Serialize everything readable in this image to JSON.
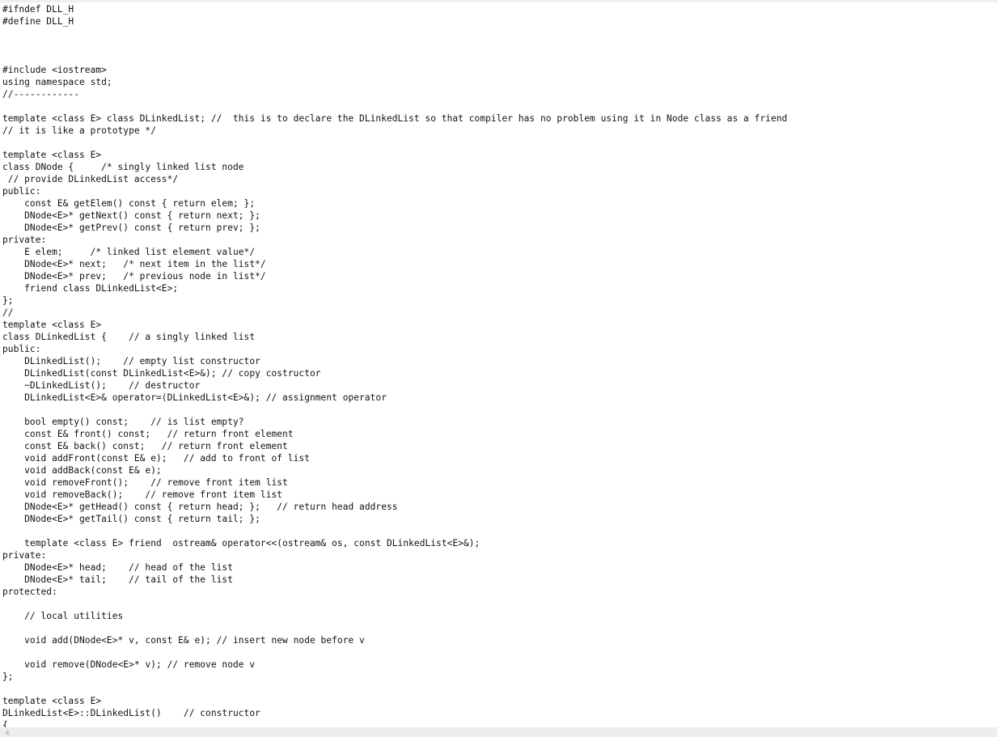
{
  "editor": {
    "lines": [
      "#ifndef DLL_H",
      "#define DLL_H",
      "",
      "",
      "",
      "#include <iostream>",
      "using namespace std;",
      "//------------",
      "",
      "template <class E> class DLinkedList; //  this is to declare the DLinkedList so that compiler has no problem using it in Node class as a friend",
      "// it is like a prototype */",
      "",
      "template <class E>",
      "class DNode {     /* singly linked list node",
      " // provide DLinkedList access*/",
      "public:",
      "    const E& getElem() const { return elem; };",
      "    DNode<E>* getNext() const { return next; };",
      "    DNode<E>* getPrev() const { return prev; };",
      "private:",
      "    E elem;     /* linked list element value*/",
      "    DNode<E>* next;   /* next item in the list*/",
      "    DNode<E>* prev;   /* previous node in list*/",
      "    friend class DLinkedList<E>;",
      "};",
      "//",
      "template <class E>",
      "class DLinkedList {    // a singly linked list",
      "public:",
      "    DLinkedList();    // empty list constructor",
      "    DLinkedList(const DLinkedList<E>&); // copy costructor",
      "    ~DLinkedList();    // destructor",
      "    DLinkedList<E>& operator=(DLinkedList<E>&); // assignment operator",
      "",
      "    bool empty() const;    // is list empty?",
      "    const E& front() const;   // return front element",
      "    const E& back() const;   // return front element",
      "    void addFront(const E& e);   // add to front of list",
      "    void addBack(const E& e);",
      "    void removeFront();    // remove front item list",
      "    void removeBack();    // remove front item list",
      "    DNode<E>* getHead() const { return head; };   // return head address",
      "    DNode<E>* getTail() const { return tail; };",
      "",
      "    template <class E> friend  ostream& operator<<(ostream& os, const DLinkedList<E>&);",
      "private:",
      "    DNode<E>* head;    // head of the list",
      "    DNode<E>* tail;    // tail of the list",
      "protected:",
      "",
      "    // local utilities",
      "",
      "    void add(DNode<E>* v, const E& e); // insert new node before v",
      "",
      "    void remove(DNode<E>* v); // remove node v",
      "};",
      "",
      "template <class E>",
      "DLinkedList<E>::DLinkedList()    // constructor",
      "{"
    ]
  },
  "scrollbar": {
    "left_arrow_icon": "scroll-left-arrow-icon"
  }
}
